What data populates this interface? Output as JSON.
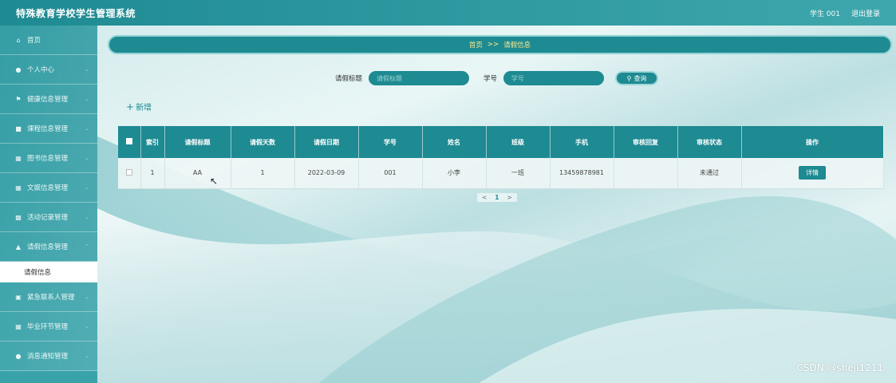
{
  "header": {
    "title": "特殊教育学校学生管理系统",
    "user": "学生 001",
    "logout": "退出登录"
  },
  "sidebar": {
    "items": [
      {
        "label": "首页",
        "icon": "home-icon"
      },
      {
        "label": "个人中心",
        "icon": "user-icon"
      },
      {
        "label": "健康信息管理",
        "icon": "flag-icon"
      },
      {
        "label": "课程信息管理",
        "icon": "monitor-icon"
      },
      {
        "label": "图书信息管理",
        "icon": "grid-icon"
      },
      {
        "label": "文娱信息管理",
        "icon": "grid-icon"
      },
      {
        "label": "活动记录管理",
        "icon": "bar-chart-icon"
      },
      {
        "label": "请假信息管理",
        "icon": "thumbs-up-icon"
      }
    ],
    "active_sub": "请假信息",
    "items_after": [
      {
        "label": "紧急联系人管理",
        "icon": "card-icon"
      },
      {
        "label": "毕业环节管理",
        "icon": "grid-icon"
      },
      {
        "label": "消息通知管理",
        "icon": "pin-icon"
      }
    ]
  },
  "breadcrumb": {
    "home": "首页",
    "sep": ">>",
    "current": "请假信息"
  },
  "search": {
    "title_label": "请假标题",
    "title_placeholder": "请假标题",
    "id_label": "学号",
    "id_placeholder": "学号",
    "button": "查询"
  },
  "add_label": "新增",
  "table": {
    "headers": [
      "索引",
      "请假标题",
      "请假天数",
      "请假日期",
      "学号",
      "姓名",
      "班级",
      "手机",
      "审核回复",
      "审核状态",
      "操作"
    ],
    "rows": [
      {
        "index": "1",
        "title": "AA",
        "days": "1",
        "date": "2022-03-09",
        "student_id": "001",
        "name": "小李",
        "class": "一班",
        "phone": "13459878981",
        "reply": "",
        "status": "未通过",
        "action": "详情"
      }
    ]
  },
  "pager": {
    "prev": "<",
    "page": "1",
    "next": ">"
  },
  "watermark": "CSDN @sheji1211",
  "colors": {
    "primary": "#1e8a92",
    "breadcrumb_text": "#ffe88a"
  }
}
